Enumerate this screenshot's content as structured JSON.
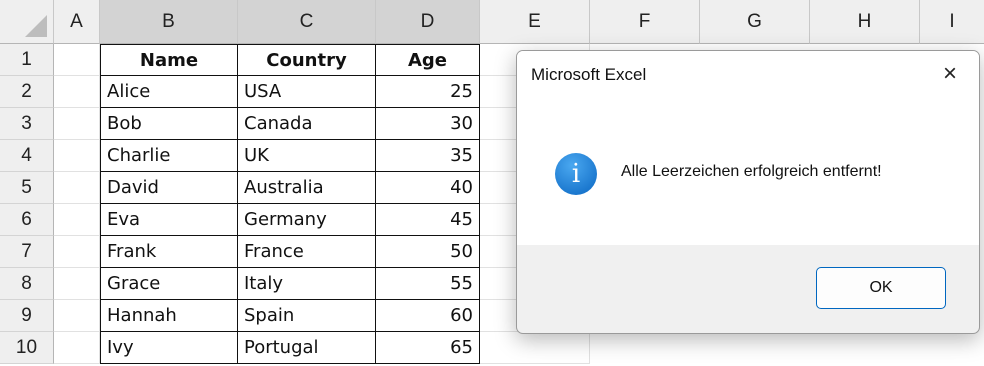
{
  "columns": [
    "A",
    "B",
    "C",
    "D",
    "E",
    "F",
    "G",
    "H",
    "I"
  ],
  "rows": [
    "1",
    "2",
    "3",
    "4",
    "5",
    "6",
    "7",
    "8",
    "9",
    "10"
  ],
  "table": {
    "headers": [
      "Name",
      "Country",
      "Age"
    ],
    "records": [
      [
        "Alice",
        "USA",
        "25"
      ],
      [
        "Bob",
        "Canada",
        "30"
      ],
      [
        "Charlie",
        "UK",
        "35"
      ],
      [
        "David",
        "Australia",
        "40"
      ],
      [
        "Eva",
        "Germany",
        "45"
      ],
      [
        "Frank",
        "France",
        "50"
      ],
      [
        "Grace",
        "Italy",
        "55"
      ],
      [
        "Hannah",
        "Spain",
        "60"
      ],
      [
        "Ivy",
        "Portugal",
        "65"
      ]
    ]
  },
  "dialog": {
    "title": "Microsoft Excel",
    "close_icon": "×",
    "info_icon": "i",
    "message": "Alle Leerzeichen erfolgreich entfernt!",
    "ok_label": "OK"
  },
  "colors": {
    "accent": "#0067c0",
    "info_icon": "#0a66c2"
  }
}
